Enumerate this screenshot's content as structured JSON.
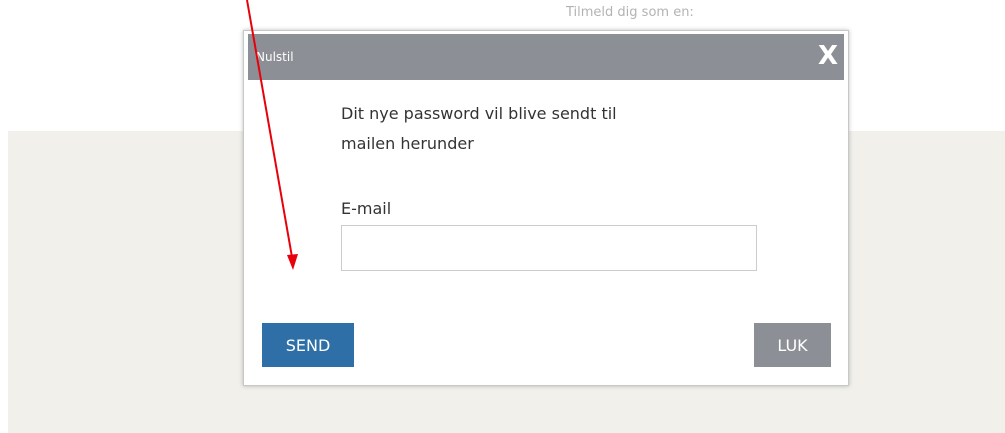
{
  "background": {
    "signup_text": "Tilmeld dig som en:"
  },
  "dialog": {
    "title": "Nulstil",
    "close_glyph": "X",
    "message_line1": "Dit nye password vil blive sendt til",
    "message_line2": "mailen herunder",
    "email_label": "E-mail",
    "email_value": "",
    "send_label": "SEND",
    "close_label": "LUK"
  },
  "colors": {
    "header": "#8c9096",
    "send_button": "#2d6fa6",
    "close_button": "#8c9096",
    "annotation_arrow": "#e8000b",
    "panel_background": "#f1f0eb"
  }
}
